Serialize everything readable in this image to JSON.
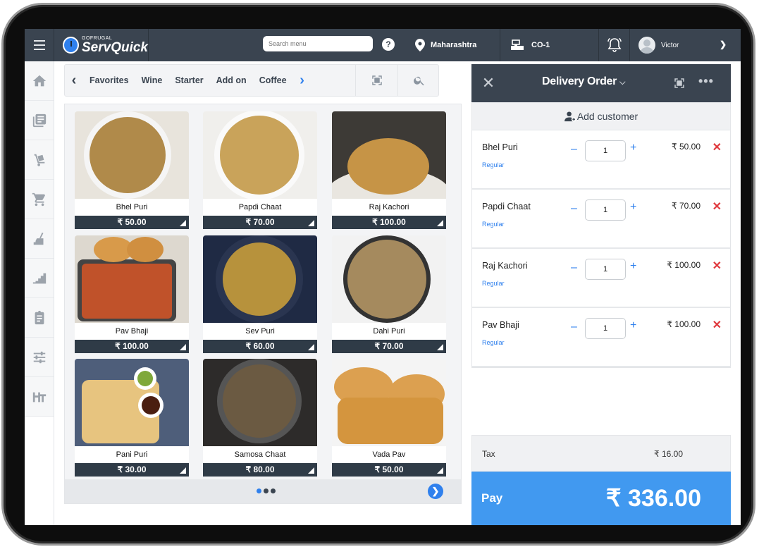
{
  "app": {
    "brand_small": "GOFRUGAL",
    "brand_name": "ServQuick"
  },
  "topbar": {
    "search_placeholder": "Search menu",
    "help": "?",
    "location": "Maharashtra",
    "counter": "CO-1",
    "user_name": "Victor"
  },
  "sidebar": {
    "items": [
      {
        "icon": "home-icon"
      },
      {
        "icon": "catalog-icon"
      },
      {
        "icon": "delivery-trolley-icon"
      },
      {
        "icon": "cart-icon"
      },
      {
        "icon": "cleaning-icon"
      },
      {
        "icon": "bar-steps-icon"
      },
      {
        "icon": "clipboard-icon"
      },
      {
        "icon": "sliders-icon"
      },
      {
        "icon": "ht-icon"
      }
    ]
  },
  "categories": {
    "items": [
      "Favorites",
      "Wine",
      "Starter",
      "Add on",
      "Coffee"
    ]
  },
  "products": [
    {
      "name": "Bhel Puri",
      "price": "₹ 50.00",
      "color": "#b08a4a"
    },
    {
      "name": "Papdi Chaat",
      "price": "₹ 70.00",
      "color": "#c9a35a"
    },
    {
      "name": "Raj Kachori",
      "price": "₹ 100.00",
      "color": "#c69446"
    },
    {
      "name": "Pav Bhaji",
      "price": "₹ 100.00",
      "color": "#c0522a"
    },
    {
      "name": "Sev Puri",
      "price": "₹ 60.00",
      "color": "#b7923c"
    },
    {
      "name": "Dahi Puri",
      "price": "₹ 70.00",
      "color": "#a58a5e"
    },
    {
      "name": "Pani Puri",
      "price": "₹ 30.00",
      "color": "#4e5e7a"
    },
    {
      "name": "Samosa Chaat",
      "price": "₹ 80.00",
      "color": "#6b5a42"
    },
    {
      "name": "Vada Pav",
      "price": "₹ 50.00",
      "color": "#d4953e"
    }
  ],
  "pagination": {
    "pages": 3,
    "active": 1
  },
  "order": {
    "title": "Delivery Order",
    "add_customer": "Add customer",
    "items": [
      {
        "name": "Bhel Puri",
        "variant": "Regular",
        "qty": "1",
        "price": "₹ 50.00"
      },
      {
        "name": "Papdi Chaat",
        "variant": "Regular",
        "qty": "1",
        "price": "₹ 70.00"
      },
      {
        "name": "Raj Kachori",
        "variant": "Regular",
        "qty": "1",
        "price": "₹ 100.00"
      },
      {
        "name": "Pav Bhaji",
        "variant": "Regular",
        "qty": "1",
        "price": "₹ 100.00"
      }
    ],
    "tax_label": "Tax",
    "tax_value": "₹ 16.00",
    "pay_label": "Pay",
    "total": "₹ 336.00"
  },
  "colors": {
    "header": "#3a4450",
    "accent": "#2f80ed",
    "pay": "#4199f0",
    "delete": "#e0393e"
  }
}
